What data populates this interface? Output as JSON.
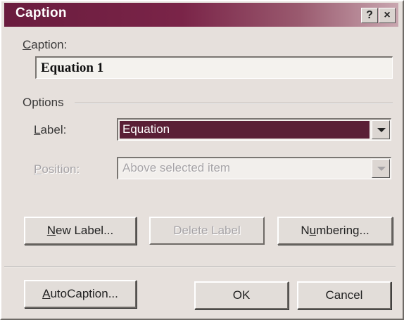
{
  "window": {
    "title": "Caption",
    "help_glyph": "?",
    "close_glyph": "×"
  },
  "caption": {
    "label_first": "C",
    "label_rest": "aption:",
    "value": "Equation 1"
  },
  "options": {
    "group_label": "Options",
    "label_field": {
      "label_first": "L",
      "label_rest": "abel:",
      "selected": "Equation"
    },
    "position_field": {
      "label_first": "P",
      "label_rest": "osition:",
      "selected": "Above selected item",
      "enabled": false
    }
  },
  "buttons": {
    "new_label": {
      "first": "N",
      "rest": "ew Label..."
    },
    "delete_label": {
      "text": "Delete Label",
      "enabled": false
    },
    "numbering": {
      "pre": "N",
      "u": "u",
      "post": "mbering..."
    },
    "autocaption": {
      "first": "A",
      "rest": "utoCaption..."
    },
    "ok": "OK",
    "cancel": "Cancel"
  },
  "colors": {
    "titlebar_start": "#6a1c3e",
    "selection": "#5a1f36",
    "dialog_bg": "#e6e0dc",
    "disabled_text": "#a6a3a6"
  }
}
